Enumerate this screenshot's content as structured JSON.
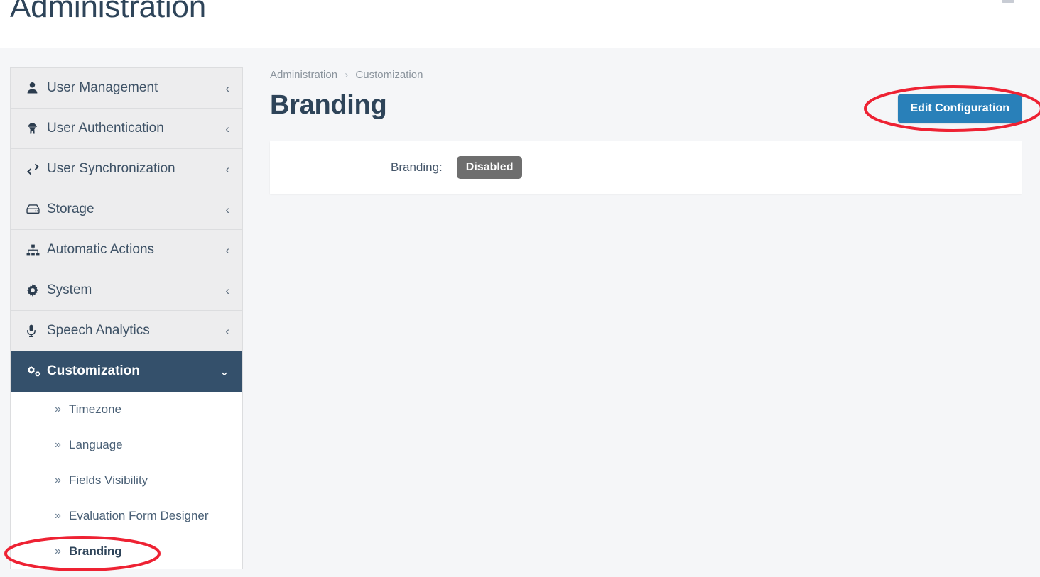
{
  "header": {
    "title": "Administration",
    "corner_icon": "collapsed-widget-nub"
  },
  "sidebar": {
    "items": [
      {
        "label": "User Management",
        "icon": "user-icon",
        "caret": "‹",
        "active": false
      },
      {
        "label": "User Authentication",
        "icon": "user-secret-icon",
        "caret": "‹",
        "active": false
      },
      {
        "label": "User Synchronization",
        "icon": "exchange-icon",
        "caret": "‹",
        "active": false
      },
      {
        "label": "Storage",
        "icon": "hard-drive-icon",
        "caret": "‹",
        "active": false
      },
      {
        "label": "Automatic Actions",
        "icon": "sitemap-icon",
        "caret": "‹",
        "active": false
      },
      {
        "label": "System",
        "icon": "gear-icon",
        "caret": "‹",
        "active": false
      },
      {
        "label": "Speech Analytics",
        "icon": "microphone-icon",
        "caret": "‹",
        "active": false
      },
      {
        "label": "Customization",
        "icon": "cogs-icon",
        "caret": "⌄",
        "active": true
      }
    ],
    "submenu": {
      "chevrons": "»",
      "items": [
        {
          "label": "Timezone",
          "current": false
        },
        {
          "label": "Language",
          "current": false
        },
        {
          "label": "Fields Visibility",
          "current": false
        },
        {
          "label": "Evaluation Form Designer",
          "current": false
        },
        {
          "label": "Branding",
          "current": true
        }
      ]
    }
  },
  "main": {
    "breadcrumb": {
      "root": "Administration",
      "separator": "›",
      "current": "Customization"
    },
    "title": "Branding",
    "edit_button": "Edit Configuration",
    "card": {
      "field_label": "Branding:",
      "status_value": "Disabled"
    }
  },
  "annotations": [
    {
      "name": "edit-configuration-highlight",
      "shape": "ellipse",
      "color": "#ee2233"
    },
    {
      "name": "branding-menu-highlight",
      "shape": "ellipse",
      "color": "#ee2233"
    }
  ],
  "colors": {
    "accent_blue": "#2980b9",
    "sidebar_active": "#34506b",
    "badge_gray": "#6e6e6e",
    "annotation_red": "#ee2233",
    "page_bg": "#f5f6f8",
    "heading_text": "#2e4459"
  }
}
